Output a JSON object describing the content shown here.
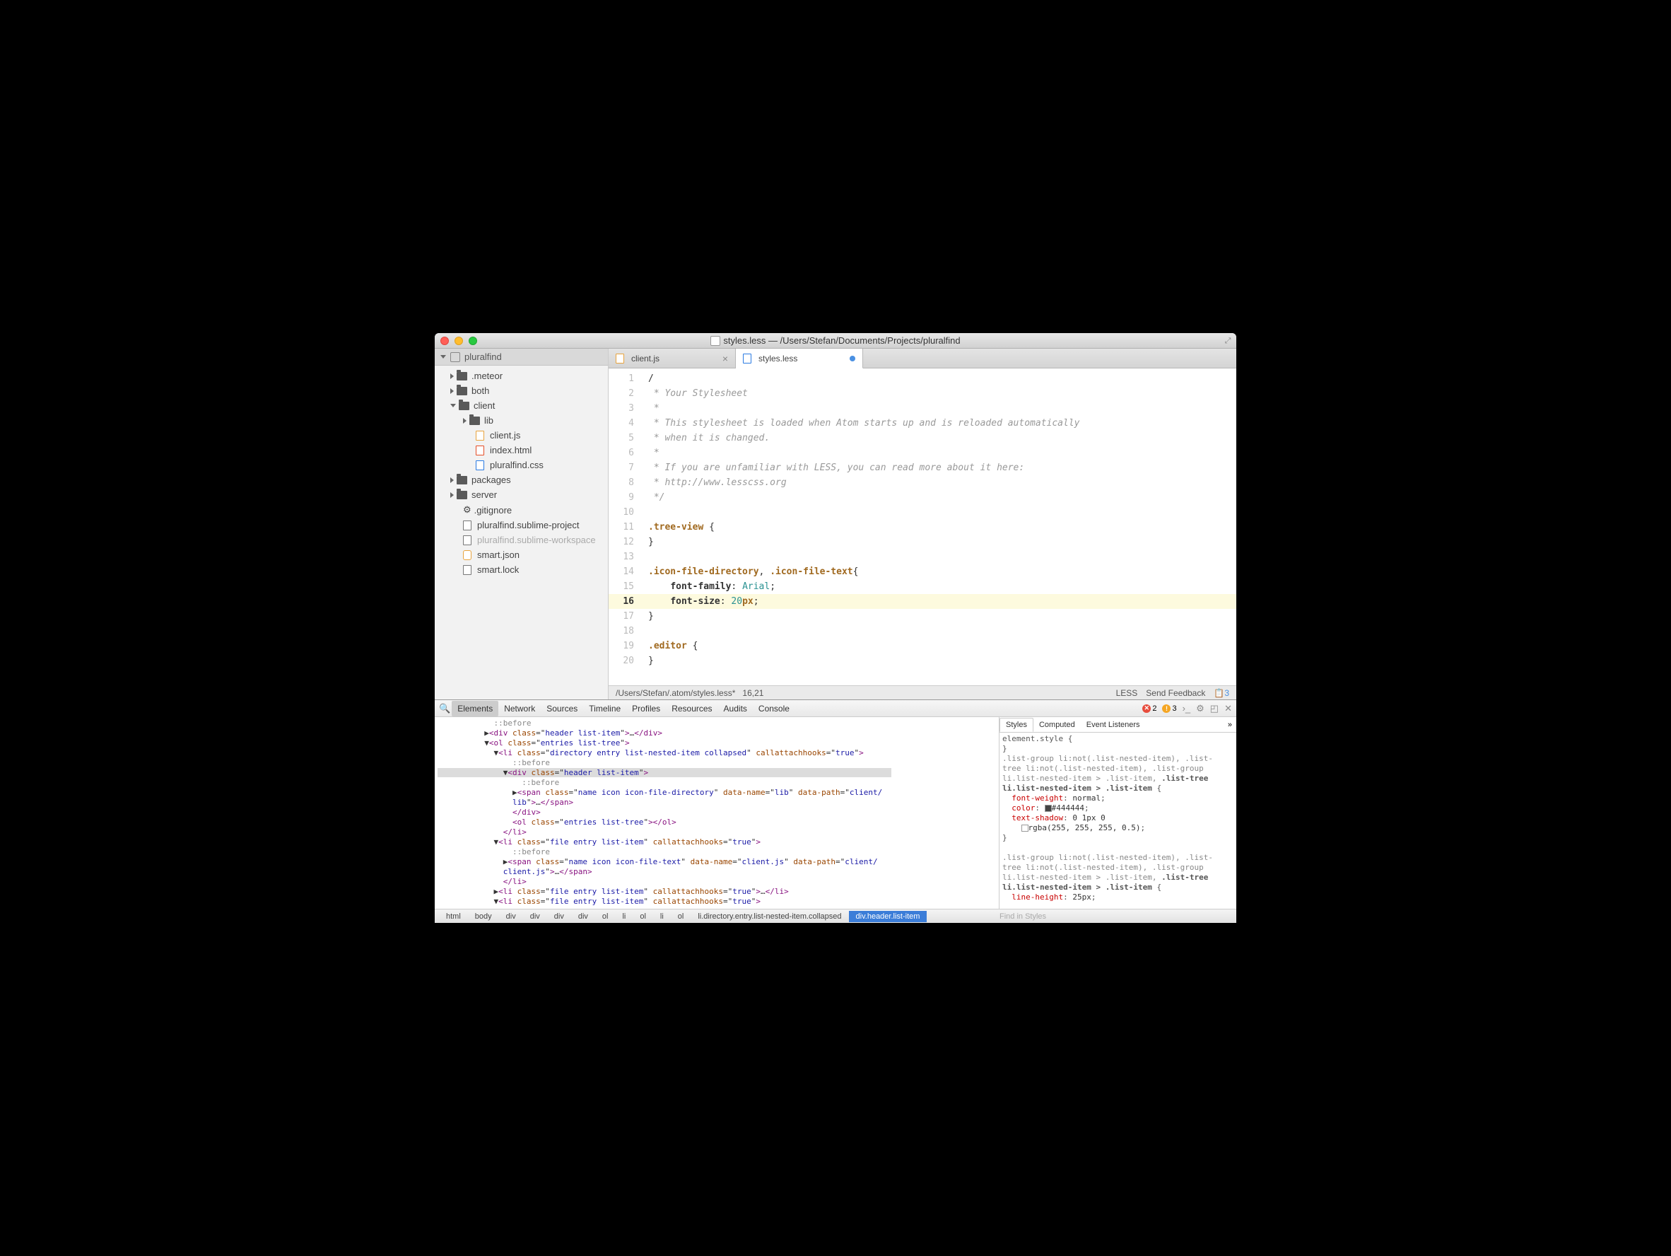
{
  "title": "styles.less — /Users/Stefan/Documents/Projects/pluralfind",
  "project": {
    "name": "pluralfind",
    "tree": [
      {
        "type": "folder",
        "name": ".meteor",
        "depth": 1,
        "open": false
      },
      {
        "type": "folder",
        "name": "both",
        "depth": 1,
        "open": false
      },
      {
        "type": "folder",
        "name": "client",
        "depth": 1,
        "open": true
      },
      {
        "type": "folder",
        "name": "lib",
        "depth": 2,
        "open": false
      },
      {
        "type": "file",
        "name": "client.js",
        "depth": 3,
        "icon": "js"
      },
      {
        "type": "file",
        "name": "index.html",
        "depth": 3,
        "icon": "html"
      },
      {
        "type": "file",
        "name": "pluralfind.css",
        "depth": 3,
        "icon": "css"
      },
      {
        "type": "folder",
        "name": "packages",
        "depth": 1,
        "open": false
      },
      {
        "type": "folder",
        "name": "server",
        "depth": 1,
        "open": false
      },
      {
        "type": "file",
        "name": ".gitignore",
        "depth": 2,
        "icon": "gear"
      },
      {
        "type": "file",
        "name": "pluralfind.sublime-project",
        "depth": 2,
        "icon": "file"
      },
      {
        "type": "file",
        "name": "pluralfind.sublime-workspace",
        "depth": 2,
        "icon": "file",
        "dim": true
      },
      {
        "type": "file",
        "name": "smart.json",
        "depth": 2,
        "icon": "db"
      },
      {
        "type": "file",
        "name": "smart.lock",
        "depth": 2,
        "icon": "file"
      }
    ]
  },
  "tabs": [
    {
      "name": "client.js",
      "icon": "js",
      "active": false,
      "close": true
    },
    {
      "name": "styles.less",
      "icon": "css",
      "active": true,
      "modified": true
    }
  ],
  "code_lines": [
    {
      "n": 1,
      "html": "/"
    },
    {
      "n": 2,
      "html": " * Your Stylesheet",
      "class": "c"
    },
    {
      "n": 3,
      "html": " *",
      "class": "c"
    },
    {
      "n": 4,
      "html": " * This stylesheet is loaded when Atom starts up and is reloaded automatically",
      "class": "c"
    },
    {
      "n": 5,
      "html": " * when it is changed.",
      "class": "c"
    },
    {
      "n": 6,
      "html": " *",
      "class": "c"
    },
    {
      "n": 7,
      "html": " * If you are unfamiliar with LESS, you can read more about it here:",
      "class": "c"
    },
    {
      "n": 8,
      "html": " * http://www.lesscss.org",
      "class": "c"
    },
    {
      "n": 9,
      "html": " */",
      "class": "c"
    },
    {
      "n": 10,
      "html": ""
    },
    {
      "n": 11,
      "html": "<span class='sel'>.tree-view</span> {"
    },
    {
      "n": 12,
      "html": "}"
    },
    {
      "n": 13,
      "html": ""
    },
    {
      "n": 14,
      "html": "<span class='sel'>.icon-file-directory</span>, <span class='sel'>.icon-file-text</span>{"
    },
    {
      "n": 15,
      "html": "    <span class='prop'>font-family</span>: <span class='val'>Arial</span>;"
    },
    {
      "n": 16,
      "html": "    <span class='prop'>font-size</span>: <span class='val'>20</span><span class='sel'>px</span>;",
      "hl": true
    },
    {
      "n": 17,
      "html": "}"
    },
    {
      "n": 18,
      "html": ""
    },
    {
      "n": 19,
      "html": "<span class='sel'>.editor</span> {"
    },
    {
      "n": 20,
      "html": "}"
    }
  ],
  "statusbar": {
    "path": "/Users/Stefan/.atom/styles.less*",
    "pos": "16,21",
    "lang": "LESS",
    "feedback": "Send Feedback",
    "deprecations": "3"
  },
  "devtools": {
    "tabs": [
      "Elements",
      "Network",
      "Sources",
      "Timeline",
      "Profiles",
      "Resources",
      "Audits",
      "Console"
    ],
    "active_tab": "Elements",
    "errors": "2",
    "warnings": "3",
    "elements_html": "            <span class='pseudo'>::before</span>\n          ▶<span class='tag'>&lt;div</span> <span class='attr'>class</span>=\"<span class='attrv'>header list-item</span>\"<span class='tag'>&gt;</span>…<span class='tag'>&lt;/div&gt;</span>\n          ▼<span class='tag'>&lt;ol</span> <span class='attr'>class</span>=\"<span class='attrv'>entries list-tree</span>\"<span class='tag'>&gt;</span>\n            ▼<span class='tag'>&lt;li</span> <span class='attr'>class</span>=\"<span class='attrv'>directory entry list-nested-item collapsed</span>\" <span class='attr'>callattachhooks</span>=\"<span class='attrv'>true</span>\"<span class='tag'>&gt;</span>\n                <span class='pseudo'>::before</span>\n<span class='sel-row'>              ▼<span class='tag'>&lt;div</span> <span class='attr'>class</span>=\"<span class='attrv'>header list-item</span>\"<span class='tag'>&gt;</span>                                                    </span>\n                  <span class='pseudo'>::before</span>\n                ▶<span class='tag'>&lt;span</span> <span class='attr'>class</span>=\"<span class='attrv'>name icon icon-file-directory</span>\" <span class='attr'>data-name</span>=\"<span class='attrv'>lib</span>\" <span class='attr'>data-path</span>=\"<span class='attrv'>client/</span>\n                <span class='attrv'>lib</span>\"<span class='tag'>&gt;</span>…<span class='tag'>&lt;/span&gt;</span>\n                <span class='tag'>&lt;/div&gt;</span>\n                <span class='tag'>&lt;ol</span> <span class='attr'>class</span>=\"<span class='attrv'>entries list-tree</span>\"<span class='tag'>&gt;&lt;/ol&gt;</span>\n              <span class='tag'>&lt;/li&gt;</span>\n            ▼<span class='tag'>&lt;li</span> <span class='attr'>class</span>=\"<span class='attrv'>file entry list-item</span>\" <span class='attr'>callattachhooks</span>=\"<span class='attrv'>true</span>\"<span class='tag'>&gt;</span>\n                <span class='pseudo'>::before</span>\n              ▶<span class='tag'>&lt;span</span> <span class='attr'>class</span>=\"<span class='attrv'>name icon icon-file-text</span>\" <span class='attr'>data-name</span>=\"<span class='attrv'>client.js</span>\" <span class='attr'>data-path</span>=\"<span class='attrv'>client/</span>\n              <span class='attrv'>client.js</span>\"<span class='tag'>&gt;</span>…<span class='tag'>&lt;/span&gt;</span>\n              <span class='tag'>&lt;/li&gt;</span>\n            ▶<span class='tag'>&lt;li</span> <span class='attr'>class</span>=\"<span class='attrv'>file entry list-item</span>\" <span class='attr'>callattachhooks</span>=\"<span class='attrv'>true</span>\"<span class='tag'>&gt;</span>…<span class='tag'>&lt;/li&gt;</span>\n            ▼<span class='tag'>&lt;li</span> <span class='attr'>class</span>=\"<span class='attrv'>file entry list-item</span>\" <span class='attr'>callattachhooks</span>=\"<span class='attrv'>true</span>\"<span class='tag'>&gt;</span>",
    "styles_tabs": [
      "Styles",
      "Computed",
      "Event Listeners"
    ],
    "styles_active": "Styles",
    "styles_body": "element.style {\n}\n<span class='css-sel'>.list-group li:not(.list-nested-item), .list-\ntree li:not(.list-nested-item), .list-group\nli.list-nested-item > .list-item, </span><b>.list-tree\nli.list-nested-item > .list-item</b> {\n  <span class='css-prop'>font-weight</span>: <span class='css-val'>normal</span>;\n  <span class='css-prop'>color</span>: <span class='swatch' style='background:#444444'></span><span class='css-val'>#444444</span>;\n  <span class='css-prop'>text-shadow</span>: <span class='css-val'>0 1px 0</span>\n    <span class='swatch' style='background:rgba(255,255,255,0.5)'></span><span class='css-val'>rgba(255, 255, 255, 0.5)</span>;\n}\n\n<span class='css-sel'>.list-group li:not(.list-nested-item), .list-\ntree li:not(.list-nested-item), .list-group\nli.list-nested-item > .list-item, </span><b>.list-tree\nli.list-nested-item > .list-item</b> {\n  <span class='css-prop'>line-height</span>: <span class='css-val'>25px</span>;",
    "crumbs": [
      "html",
      "body",
      "div",
      "div",
      "div",
      "div",
      "ol",
      "li",
      "ol",
      "li",
      "ol",
      "li.directory.entry.list-nested-item.collapsed",
      "div.header.list-item"
    ],
    "find_placeholder": "Find in Styles"
  }
}
